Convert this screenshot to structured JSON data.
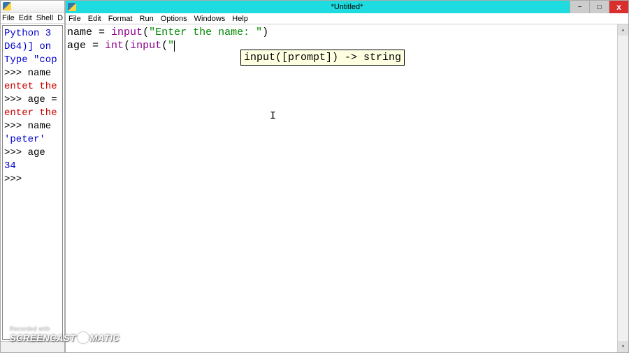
{
  "shell": {
    "menubar": [
      "File",
      "Edit",
      "Shell",
      "D"
    ],
    "lines": [
      {
        "cls": "out",
        "text": "Python 3"
      },
      {
        "cls": "out",
        "text": "D64)] on"
      },
      {
        "cls": "out",
        "text": "Type \"cop"
      },
      {
        "cls": "prompt",
        "text": ">>> name"
      },
      {
        "cls": "err",
        "text": "entet the"
      },
      {
        "cls": "prompt",
        "text": ">>> age ="
      },
      {
        "cls": "err",
        "text": "enter the"
      },
      {
        "cls": "prompt",
        "text": ">>> name"
      },
      {
        "cls": "out",
        "text": "'peter'"
      },
      {
        "cls": "prompt",
        "text": ">>> age"
      },
      {
        "cls": "out",
        "text": "34"
      },
      {
        "cls": "prompt",
        "text": ">>> "
      }
    ]
  },
  "editor": {
    "title": "*Untitled*",
    "menubar": [
      "File",
      "Edit",
      "Format",
      "Run",
      "Options",
      "Windows",
      "Help"
    ],
    "code": {
      "line1": {
        "t1": "name ",
        "eq": "=",
        "t2": " ",
        "fn": "input",
        "t3": "(",
        "s": "\"Enter the name: \"",
        "t4": ")"
      },
      "line2": {
        "t1": "age ",
        "eq": "=",
        "t2": " ",
        "fn1": "int",
        "t3": "(",
        "fn2": "input",
        "t4": "(",
        "s": "\""
      }
    },
    "tooltip": "input([prompt]) -> string"
  },
  "win_controls": {
    "min": "−",
    "max": "□",
    "close": "x"
  },
  "watermark": {
    "rec": "Recorded with",
    "brand_left": "SCREENCAST",
    "brand_right": "MATIC"
  }
}
